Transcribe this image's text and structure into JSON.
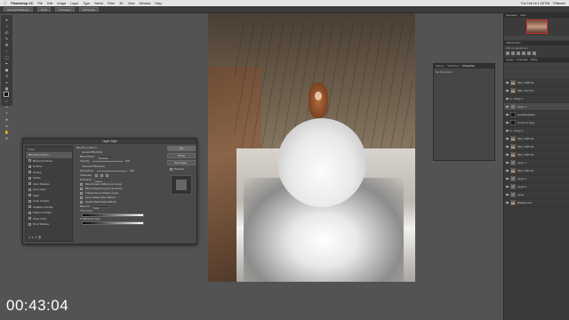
{
  "menubar": {
    "app": "Photoshop CC",
    "items": [
      "File",
      "Edit",
      "Image",
      "Layer",
      "Type",
      "Select",
      "Filter",
      "3D",
      "View",
      "Window",
      "Help"
    ],
    "clock": "Tue Feb 16  1:36 PM",
    "user": "Philemin"
  },
  "optbar": {
    "buttons": [
      "Scroll All Windows",
      "100%",
      "Fit Screen",
      "Fill Screen"
    ]
  },
  "tools": [
    "move",
    "marquee",
    "lasso",
    "quick-select",
    "crop",
    "eyedropper",
    "heal",
    "brush",
    "stamp",
    "history",
    "eraser",
    "gradient",
    "blur",
    "dodge",
    "pen",
    "type",
    "path-select",
    "shape",
    "hand",
    "zoom"
  ],
  "right_panel": {
    "navigator_tabs": [
      "Navigator",
      "Color"
    ],
    "adjustments_title": "Adjustments",
    "adjustments_sub": "Add an adjustment",
    "layers_tabs": [
      "Layers",
      "Channels",
      "Paths"
    ],
    "layers": [
      {
        "name": "IMG_7238 01",
        "thumb": "photo"
      },
      {
        "name": "IMG_7117 01",
        "thumb": "photo"
      },
      {
        "name": "Group 1",
        "thumb": "folder"
      },
      {
        "name": "Layer 1",
        "thumb": "plain"
      },
      {
        "name": "Hue/Saturation",
        "thumb": "dark"
      },
      {
        "name": "Curves 1 copy",
        "thumb": "dark"
      },
      {
        "name": "Group 2",
        "thumb": "folder"
      },
      {
        "name": "IMG_7236 01",
        "thumb": "photo"
      },
      {
        "name": "IMG_7235 01",
        "thumb": "photo"
      },
      {
        "name": "IMG_7249 01",
        "thumb": "photo"
      },
      {
        "name": "Layer 1",
        "thumb": "plain"
      },
      {
        "name": "IMG_7234 01",
        "thumb": "photo"
      },
      {
        "name": "Layer 4",
        "thumb": "plain"
      },
      {
        "name": "Layer 2",
        "thumb": "plain"
      },
      {
        "name": "Layer",
        "thumb": "plain"
      },
      {
        "name": "Background",
        "thumb": "photo"
      }
    ]
  },
  "mid_panel": {
    "tabs": [
      "History",
      "Swatches",
      "Properties"
    ],
    "active_tab": "Properties",
    "subtitle": "No Properties"
  },
  "dialog": {
    "title": "Layer Style",
    "styles_header": "Styles",
    "styles": [
      "Blending Options",
      "Bevel & Emboss",
      "Contour",
      "Texture",
      "Stroke",
      "Inner Shadow",
      "Inner Glow",
      "Satin",
      "Color Overlay",
      "Gradient Overlay",
      "Pattern Overlay",
      "Outer Glow",
      "Drop Shadow"
    ],
    "main": {
      "section1": "Blending Options",
      "general": "General Blending",
      "blend_mode_label": "Blend Mode:",
      "blend_mode": "Normal",
      "opacity_label": "Opacity:",
      "opacity": "100",
      "advanced": "Advanced Blending",
      "fill_label": "Fill Opacity:",
      "fill": "100",
      "channels_label": "Channels:",
      "knockout_label": "Knockout:",
      "knockout": "None",
      "options": [
        "Blend Interior Effects as Group",
        "Blend Clipped Layers as Group",
        "Transparency Shapes Layer",
        "Layer Mask Hides Effects",
        "Vector Mask Hides Effects"
      ],
      "blend_if_label": "Blend If:",
      "blend_if": "Gray",
      "this_layer": "This Layer:",
      "underlying": "Underlying Layer:"
    },
    "buttons": {
      "ok": "OK",
      "reset": "Reset",
      "new_style": "New Style...",
      "preview": "Preview"
    }
  },
  "timer": "00:43:04"
}
